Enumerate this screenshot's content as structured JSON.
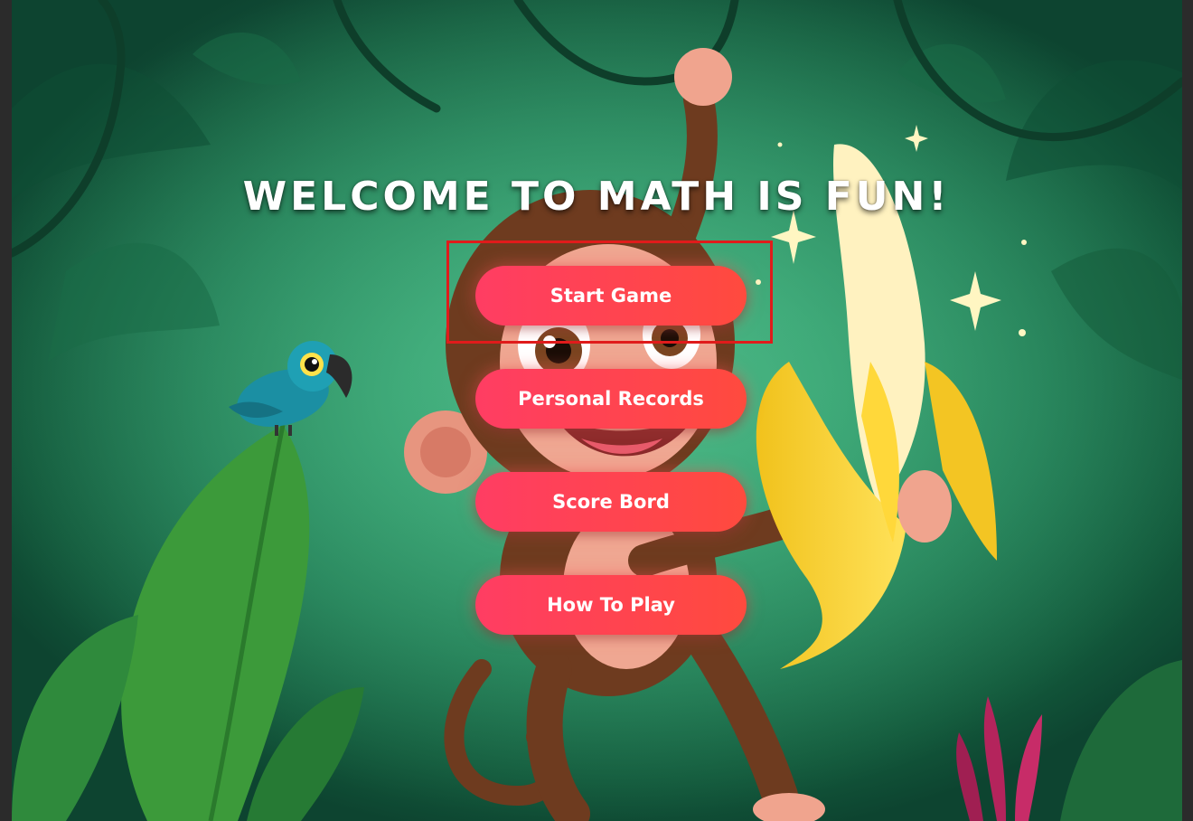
{
  "title": "WELCOME TO MATH IS FUN!",
  "menu": {
    "start_game": "Start Game",
    "personal_records": "Personal Records",
    "score_board": "Score Bord",
    "how_to_play": "How To Play"
  },
  "colors": {
    "button_gradient_start": "#ff3d63",
    "button_gradient_end": "#ff4a3e",
    "highlight": "#e01b1b",
    "jungle": "#2f9a69"
  },
  "illustration": {
    "characters": [
      "monkey-icon",
      "banana-icon",
      "parrot-icon"
    ],
    "decorations": [
      "vine-icon",
      "leaf-icon",
      "sparkle-icon",
      "flower-icon"
    ]
  }
}
